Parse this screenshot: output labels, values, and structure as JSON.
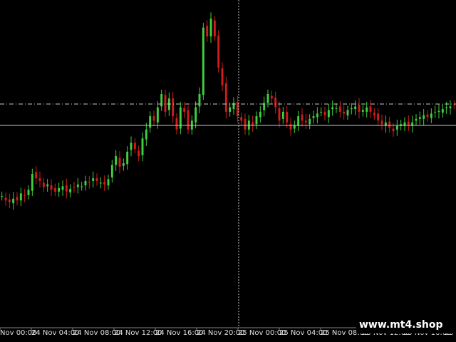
{
  "watermark": {
    "text": "www.mt4.shop"
  },
  "colors": {
    "background": "#000000",
    "bull": "#3fcf3f",
    "bear": "#d01c1c",
    "wick_bull": "#3fcf3f",
    "wick_bear": "#d01c1c",
    "price_line": "#c8c8c8",
    "crosshair": "#c8c8c8",
    "axis_text": "#e0e0e0"
  },
  "chart_data": {
    "type": "candlestick",
    "x_ticks": [
      "Nov 00:00",
      "24 Nov 04:00",
      "24 Nov 08:00",
      "24 Nov 12:00",
      "24 Nov 16:00",
      "24 Nov 20:00",
      "25 Nov 00:00",
      "25 Nov 04:00",
      "25 Nov 08:00",
      "25 Nov 12:00",
      "25 Nov 16:00",
      "25 N"
    ],
    "grid": false,
    "price_levels": {
      "current_price": 0.47,
      "crosshair_price": 0.52
    },
    "crosshair_x_index": 108,
    "y_range": [
      -1,
      1
    ],
    "candles": []
  }
}
